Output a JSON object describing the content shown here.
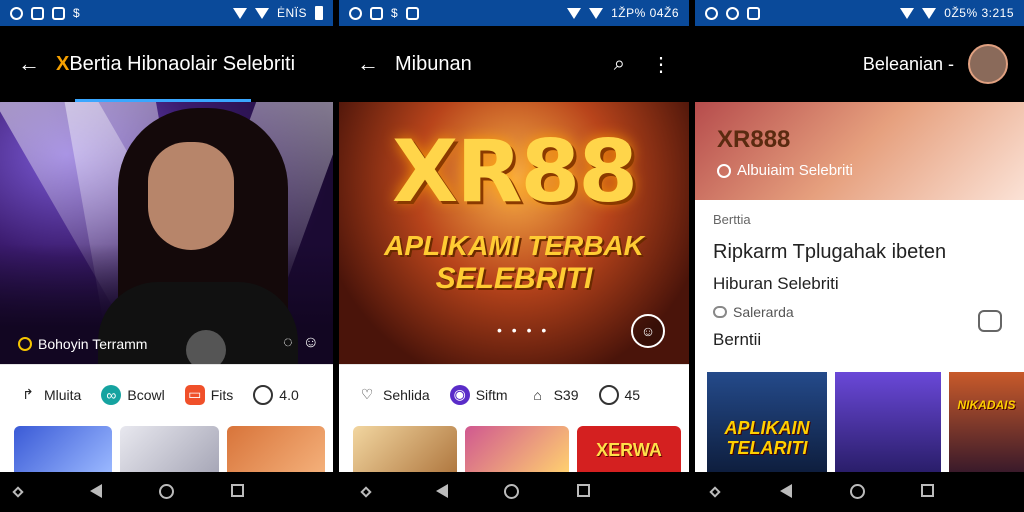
{
  "panel1": {
    "status": {
      "left_icons": [
        "signal-icon",
        "photo-icon",
        "mail-icon",
        "dollar-icon"
      ],
      "right_text": "ĖNÏS"
    },
    "appbar": {
      "back": "←",
      "title_prefix": "X",
      "title_rest": "Bertia Hibnaolair Selebriti"
    },
    "hero": {
      "caption": "Bohoyin Terramm"
    },
    "actions": [
      {
        "icon": "share-icon",
        "label": "Mluita"
      },
      {
        "icon": "teal-circle-icon",
        "label": "Bcowl"
      },
      {
        "icon": "red-square-icon",
        "label": "Fits"
      },
      {
        "icon": "comment-icon",
        "label": "4.0"
      }
    ]
  },
  "panel2": {
    "status": {
      "right_text": "1ŽP% 04Ž6"
    },
    "appbar": {
      "back": "←",
      "title": "Mibunan"
    },
    "hero": {
      "brand": "XR88",
      "line1": "APLIKAMI TERBAK",
      "line2": "SELEBRITI",
      "dots": "• • • •"
    },
    "actions": [
      {
        "icon": "like-icon",
        "label": "Sehlida"
      },
      {
        "icon": "purple-circle-icon",
        "label": "Siftm"
      },
      {
        "icon": "home-icon",
        "label": "S39"
      },
      {
        "icon": "comment-icon",
        "label": "45"
      }
    ],
    "thumb_text": "XERWA"
  },
  "panel3": {
    "status": {
      "right_text": "0Ž5% 3:215"
    },
    "appbar": {
      "title": "Beleanian -"
    },
    "hero": {
      "brand": "XR888",
      "sub": "Albuiaim Selebriti"
    },
    "body": {
      "kategori": "Berttia",
      "headline": "Ripkarm Tplugahak ibeten",
      "line2": "Hiburan Selebriti",
      "meta": "Salerarda",
      "section": "Berntii"
    },
    "thumbs": [
      {
        "text": "APLIKAIN TELARITI"
      },
      {
        "text": ""
      },
      {
        "text": "NIKADAIS"
      }
    ]
  }
}
